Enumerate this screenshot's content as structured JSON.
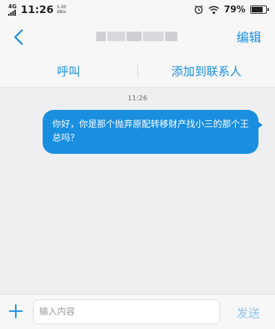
{
  "status_bar": {
    "network": "4G",
    "time": "11:26",
    "speed_value": "5.00",
    "speed_unit": "KB/s",
    "battery": "79%",
    "battery_level": 0.79,
    "icons": [
      "signal-icon",
      "alarm-icon",
      "wifi-icon",
      "battery-icon"
    ]
  },
  "header": {
    "back_icon": "chevron-left-icon",
    "edit_label": "编辑"
  },
  "actions": {
    "call_label": "呼叫",
    "add_contact_label": "添加到联系人"
  },
  "chat": {
    "timestamp": "11:26",
    "messages": [
      {
        "direction": "outgoing",
        "text": "你好，你是那个抛弃原配转移财产找小三的那个王总吗？"
      }
    ]
  },
  "input_bar": {
    "plus_icon": "plus-icon",
    "placeholder": "输入内容",
    "send_label": "发送"
  },
  "colors": {
    "accent": "#1a8fe0",
    "send_disabled": "#8cc4ee",
    "background": "#efeff1"
  }
}
